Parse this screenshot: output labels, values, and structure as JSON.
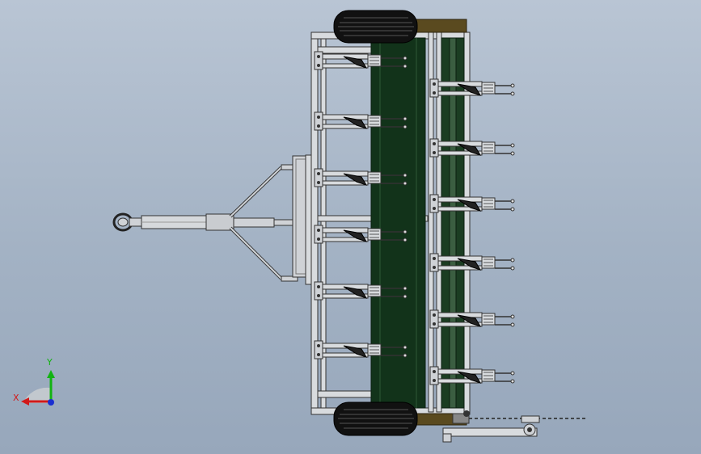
{
  "viewport": {
    "background_top": "#b9c5d4",
    "background_bottom": "#97a7bb"
  },
  "model": {
    "frame_color": "#cfd2d6",
    "hopper_color": "#12331a",
    "tire_color": "#111111",
    "soil_box_color": "#5a4a1f"
  },
  "triad": {
    "x_label": "X",
    "y_label": "Y",
    "x_color": "#d11a1a",
    "y_color": "#12b312",
    "z_color": "#1a2fd1"
  }
}
